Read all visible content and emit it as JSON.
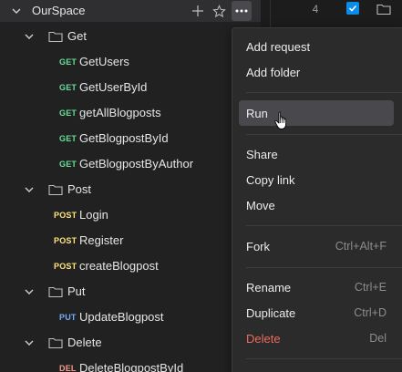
{
  "sidebar": {
    "workspace": {
      "name": "OurSpace"
    },
    "folders": [
      {
        "name": "Get",
        "requests": [
          {
            "method": "GET",
            "name": "GetUsers"
          },
          {
            "method": "GET",
            "name": "GetUserById"
          },
          {
            "method": "GET",
            "name": "getAllBlogposts"
          },
          {
            "method": "GET",
            "name": "GetBlogpostById"
          },
          {
            "method": "GET",
            "name": "GetBlogpostByAuthor"
          }
        ]
      },
      {
        "name": "Post",
        "requests": [
          {
            "method": "POST",
            "name": "Login"
          },
          {
            "method": "POST",
            "name": "Register"
          },
          {
            "method": "POST",
            "name": "createBlogpost"
          }
        ]
      },
      {
        "name": "Put",
        "requests": [
          {
            "method": "PUT",
            "name": "UpdateBlogpost"
          }
        ]
      },
      {
        "name": "Delete",
        "requests": [
          {
            "method": "DEL",
            "name": "DeleteBlogpostById"
          }
        ]
      }
    ]
  },
  "strip": {
    "row_number": "4"
  },
  "context_menu": {
    "add_request": "Add request",
    "add_folder": "Add folder",
    "run": "Run",
    "share": "Share",
    "copy_link": "Copy link",
    "move": "Move",
    "fork": {
      "label": "Fork",
      "shortcut": "Ctrl+Alt+F"
    },
    "rename": {
      "label": "Rename",
      "shortcut": "Ctrl+E"
    },
    "duplicate": {
      "label": "Duplicate",
      "shortcut": "Ctrl+D"
    },
    "delete": {
      "label": "Delete",
      "shortcut": "Del"
    }
  },
  "colors": {
    "get": "#6bdd9a",
    "post": "#ffe47e",
    "put": "#74aef6",
    "del": "#f79a8e",
    "danger": "#ec6a5e",
    "accent": "#0c8ce9"
  },
  "icons": [
    "chevron-down-icon",
    "folder-icon",
    "plus-icon",
    "star-icon",
    "more-icon",
    "checkbox-checked-icon",
    "hand-cursor-icon"
  ]
}
